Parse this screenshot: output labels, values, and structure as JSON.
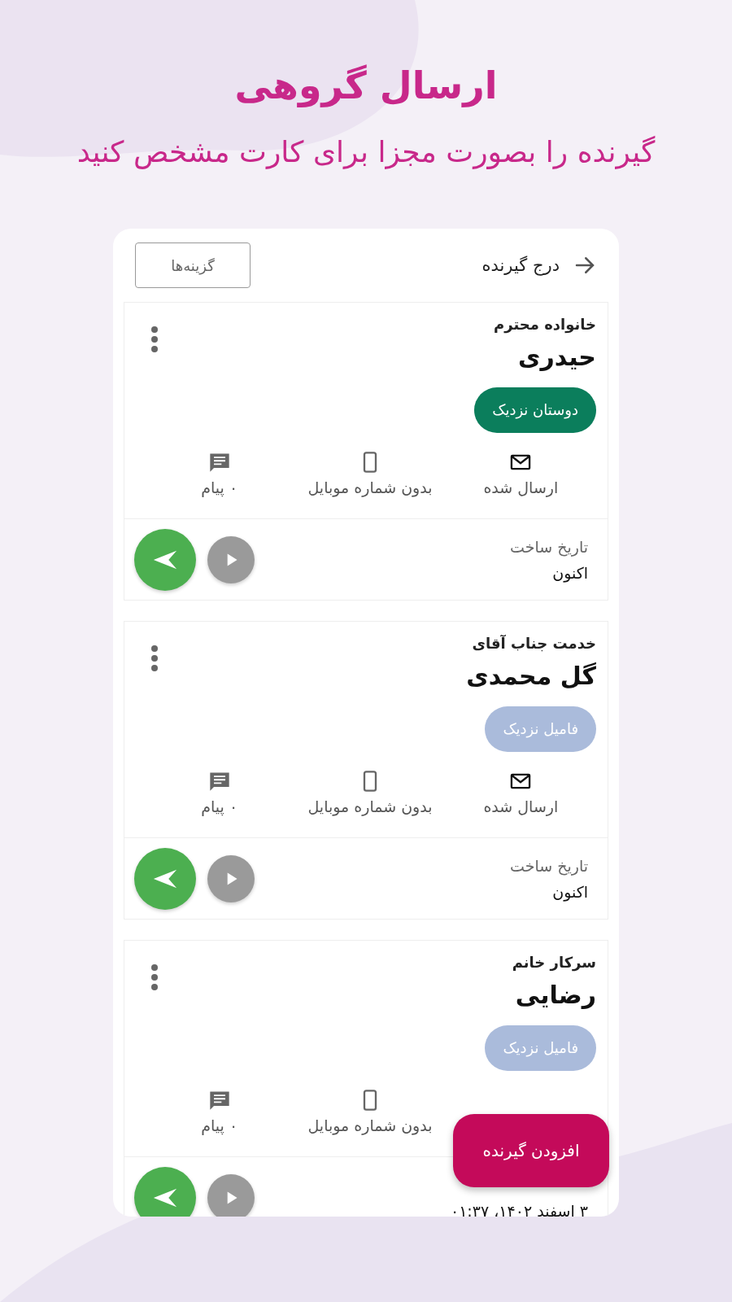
{
  "header": {
    "title": "ارسال گروهی",
    "subtitle": "گیرنده را بصورت مجزا برای کارت مشخص کنید"
  },
  "toolbar": {
    "title": "درج گیرنده",
    "options_button": "گزینه‌ها"
  },
  "cards": [
    {
      "salutation": "خانواده محترم",
      "name": "حیدری",
      "tag": {
        "label": "دوستان نزدیک",
        "color": "#0b7e5c"
      },
      "stats": {
        "sent": "ارسال شده",
        "mobile": "بدون شماره موبایل",
        "messages": "۰ پیام"
      },
      "date_label": "تاریخ ساخت",
      "date": "اکنون"
    },
    {
      "salutation": "خدمت جناب آقای",
      "name": "گل محمدی",
      "tag": {
        "label": "فامیل نزدیک",
        "color": "#aabbdb"
      },
      "stats": {
        "sent": "ارسال شده",
        "mobile": "بدون شماره موبایل",
        "messages": "۰ پیام"
      },
      "date_label": "تاریخ ساخت",
      "date": "اکنون"
    },
    {
      "salutation": "سرکار خانم",
      "name": "رضایی",
      "tag": {
        "label": "فامیل نزدیک",
        "color": "#aabbdb"
      },
      "stats": {
        "mobile": "بدون شماره موبایل",
        "messages": "۰ پیام"
      },
      "date": "۳ اسفند ۱۴۰۲، ۰۱:۳۷"
    }
  ],
  "fab": "افزودن گیرنده"
}
